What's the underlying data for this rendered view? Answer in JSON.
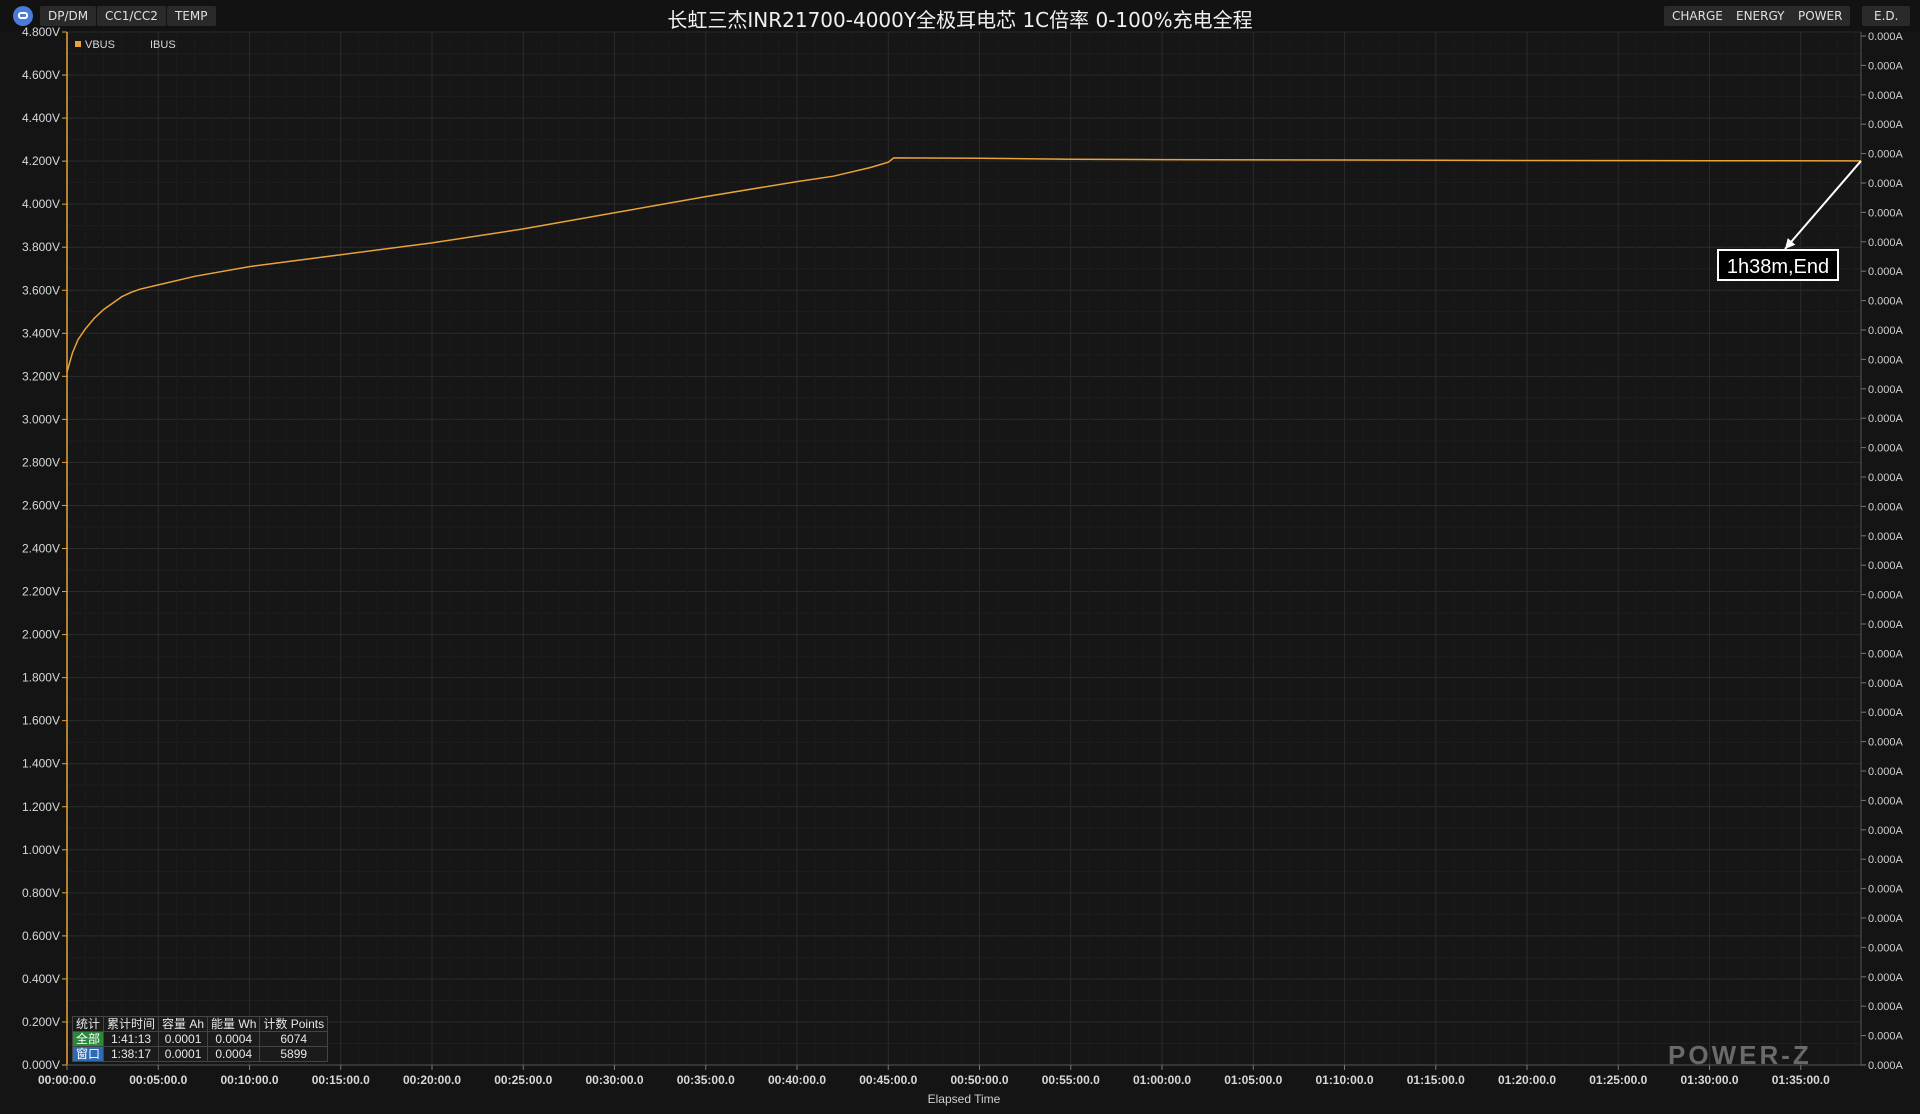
{
  "toolbar": {
    "tabs_left": [
      "DP/DM",
      "CC1/CC2",
      "TEMP"
    ],
    "tabs_right": [
      "CHARGE",
      "ENERGY",
      "POWER",
      "E.D."
    ]
  },
  "colors": {
    "vbus": "#e8a33a",
    "background": "#141414",
    "grid": "#2b2b2b"
  },
  "chart_data": {
    "type": "line",
    "title": "长虹三杰INR21700-4000Y全极耳电芯 1C倍率 0-100%充电全程",
    "xlabel": "Elapsed Time",
    "legend": [
      "VBUS",
      "IBUS"
    ],
    "legend_position": "top-left",
    "grid": true,
    "x_unit": "minutes",
    "x_ticks": [
      "00:00:00.0",
      "00:05:00.0",
      "00:10:00.0",
      "00:15:00.0",
      "00:20:00.0",
      "00:25:00.0",
      "00:30:00.0",
      "00:35:00.0",
      "00:40:00.0",
      "00:45:00.0",
      "00:50:00.0",
      "00:55:00.0",
      "01:00:00.0",
      "01:05:00.0",
      "01:10:00.0",
      "01:15:00.0",
      "01:20:00.0",
      "01:25:00.0",
      "01:30:00.0",
      "01:35:00.0"
    ],
    "y_left_ticks": [
      "0.000V",
      "0.200V",
      "0.400V",
      "0.600V",
      "0.800V",
      "1.000V",
      "1.200V",
      "1.400V",
      "1.600V",
      "1.800V",
      "2.000V",
      "2.200V",
      "2.400V",
      "2.600V",
      "2.800V",
      "3.000V",
      "3.200V",
      "3.400V",
      "3.600V",
      "3.800V",
      "4.000V",
      "4.200V",
      "4.400V",
      "4.600V",
      "4.800V"
    ],
    "y_right_tick_label": "0.000A",
    "y_right_tick_count": 36,
    "ylim_left": [
      0,
      4.8
    ],
    "xlim": [
      0,
      98.3
    ],
    "series": [
      {
        "name": "VBUS",
        "x": [
          0,
          0.3,
          0.6,
          1,
          1.5,
          2,
          2.5,
          3,
          3.5,
          4,
          5,
          7,
          10,
          15,
          20,
          25,
          30,
          35,
          40,
          42,
          44,
          45,
          45.3,
          50,
          55,
          60,
          70,
          80,
          90,
          98.3
        ],
        "y": [
          3.22,
          3.31,
          3.37,
          3.42,
          3.47,
          3.51,
          3.54,
          3.57,
          3.59,
          3.605,
          3.625,
          3.665,
          3.71,
          3.765,
          3.82,
          3.885,
          3.96,
          4.035,
          4.105,
          4.13,
          4.17,
          4.195,
          4.215,
          4.213,
          4.209,
          4.207,
          4.205,
          4.203,
          4.202,
          4.201
        ]
      }
    ],
    "annotation": "1h38m,End"
  },
  "stats": {
    "headers": [
      "统计",
      "累计时间",
      "容量 Ah",
      "能量 Wh",
      "计数 Points"
    ],
    "rows": [
      [
        "全部",
        "1:41:13",
        "0.0001",
        "0.0004",
        "6074"
      ],
      [
        "窗口",
        "1:38:17",
        "0.0001",
        "0.0004",
        "5899"
      ]
    ]
  },
  "logo": "POWER-Z"
}
